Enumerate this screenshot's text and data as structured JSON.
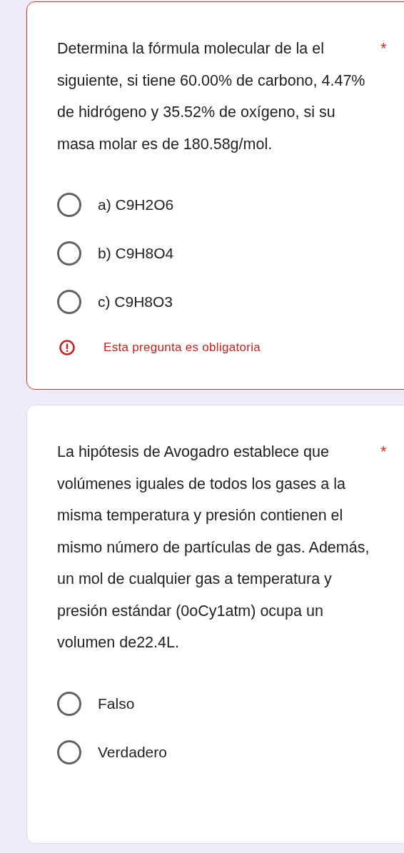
{
  "questions": [
    {
      "title": "Determina la fórmula molecular de la el siguiente, si tiene 60.00% de carbono, 4.47% de hidrógeno y 35.52% de oxígeno, si su masa molar es de 180.58g/mol.",
      "required_mark": "*",
      "options": [
        {
          "label": "a) C9H2O6",
          "selected": false
        },
        {
          "label": "b) C9H8O4",
          "selected": false
        },
        {
          "label": "c) C9H8O3",
          "selected": false
        }
      ],
      "error": "Esta pregunta es obligatoria"
    },
    {
      "title": "La hipótesis de Avogadro establece que volúmenes iguales de todos los gases a la misma temperatura y presión contienen el mismo número de partículas de gas. Además, un mol de cualquier gas a temperatura y presión estándar (0oCy1atm) ocupa un volumen de22.4L.",
      "required_mark": "*",
      "options": [
        {
          "label": "Falso",
          "selected": false
        },
        {
          "label": "Verdadero",
          "selected": false
        }
      ]
    }
  ]
}
